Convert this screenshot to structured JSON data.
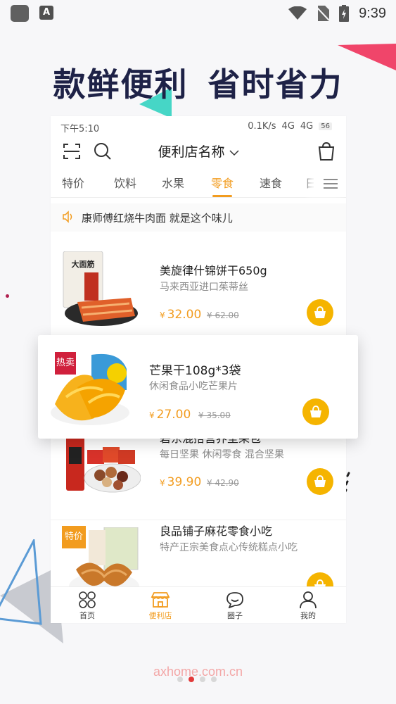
{
  "os_status": {
    "time": "9:39",
    "app_icon_letter": "A"
  },
  "headline": {
    "part1": "款鲜便利",
    "part2": "省时省力"
  },
  "phone": {
    "status": {
      "time": "下午5:10",
      "speed": "0.1K/s",
      "net1": "4G",
      "net2": "4G",
      "battery": "56"
    },
    "store_name": "便利店名称",
    "tabs": [
      "特价",
      "饮料",
      "水果",
      "零食",
      "速食",
      "日"
    ],
    "active_tab": "零食",
    "notice": "康师傅红烧牛肉面 就是这个味儿",
    "items": [
      {
        "name": "美旋律什锦饼干650g",
        "desc": "马来西亚进口茱蒂丝",
        "price": "32.00",
        "old_price": "¥ 62.00",
        "currency": "¥",
        "image_text": "大面筋"
      },
      {
        "name": "碧东混搭营养坚果包",
        "desc": "每日坚果 休闲零食 混合坚果",
        "price": "39.90",
        "old_price": "¥ 42.90",
        "currency": "¥"
      },
      {
        "name": "良品铺子麻花零食小吃",
        "desc": "特产正宗美食点心传统糕点小吃",
        "price": "",
        "old_price": "",
        "currency": "¥",
        "tag": "特价"
      }
    ],
    "tabbar": [
      {
        "label": "首页",
        "icon": "home-circles-icon"
      },
      {
        "label": "便利店",
        "icon": "store-icon"
      },
      {
        "label": "圈子",
        "icon": "chat-icon"
      },
      {
        "label": "我的",
        "icon": "person-icon"
      }
    ],
    "active_tabbar": "便利店"
  },
  "featured": {
    "tag": "热卖",
    "name": "芒果干108g*3袋",
    "desc": "休闲食品小吃芒果片",
    "price": "27.00",
    "old_price": "¥ 35.00",
    "currency": "¥"
  },
  "watermark": "axhome.com.cn",
  "pager": {
    "count": 4,
    "active_index": 1
  },
  "colors": {
    "accent": "#f29c1f",
    "cart": "#f5b400",
    "headline": "#1e2247",
    "hot": "#d0203c",
    "deco_pink": "#f0456a",
    "deco_teal": "#46d6c6",
    "deco_blue": "#5b9bd5"
  }
}
